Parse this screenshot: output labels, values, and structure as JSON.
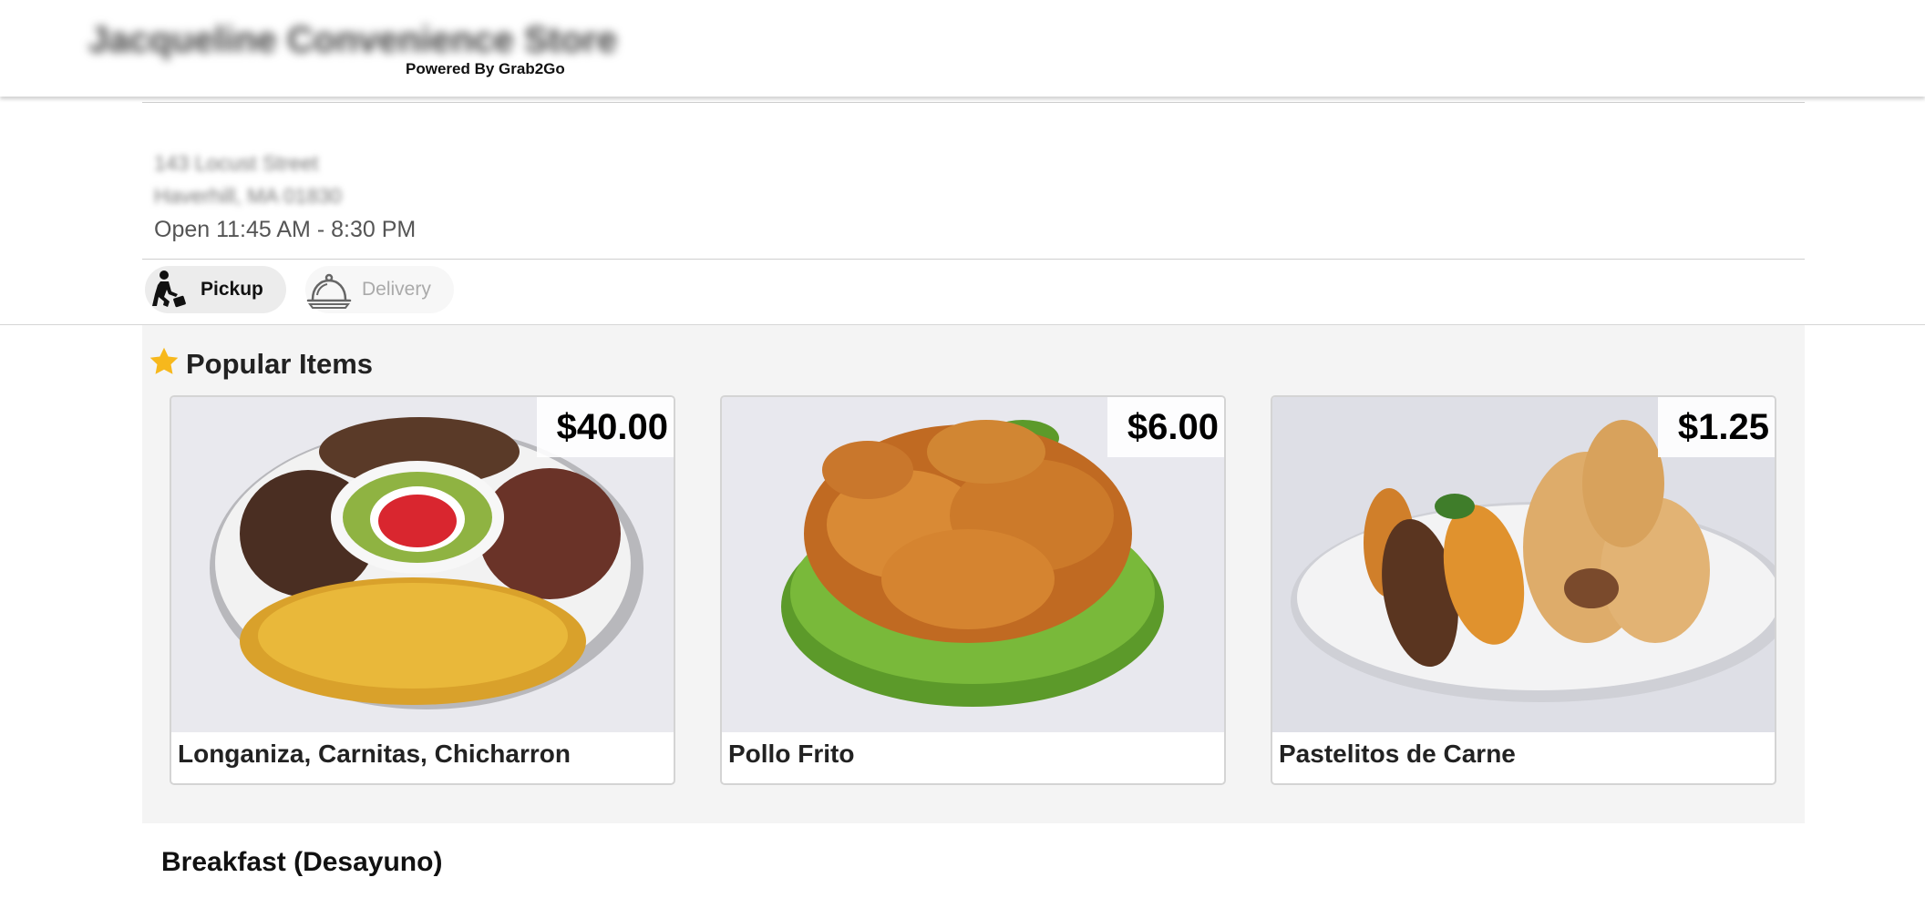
{
  "header": {
    "store_name": "Jacqueline Convenience Store",
    "powered_by": "Powered By Grab2Go"
  },
  "store_info": {
    "address_line1": "143 Locust Street",
    "address_line2": "Haverhill, MA 01830",
    "hours": "Open 11:45 AM - 8:30 PM"
  },
  "order_modes": [
    {
      "label": "Pickup",
      "icon": "walking-person-luggage-icon",
      "selected": true
    },
    {
      "label": "Delivery",
      "icon": "food-cloche-icon",
      "selected": false
    }
  ],
  "popular": {
    "title": "Popular Items",
    "icon": "star-icon",
    "star_color": "#f7b81c",
    "items": [
      {
        "name": "Longaniza, Carnitas, Chicharron",
        "price": "$40.00"
      },
      {
        "name": "Pollo Frito",
        "price": "$6.00"
      },
      {
        "name": "Pastelitos de Carne",
        "price": "$1.25"
      }
    ]
  },
  "menu_sections": [
    {
      "title": "Breakfast (Desayuno)"
    }
  ]
}
